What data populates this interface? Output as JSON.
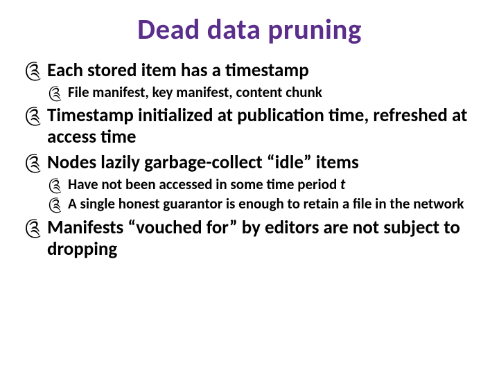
{
  "title": "Dead data pruning",
  "bullets": {
    "b1": "Each stored item has a timestamp",
    "b1a": "File manifest, key manifest, content chunk",
    "b2": "Timestamp initialized at publication time, refreshed at access time",
    "b3": "Nodes lazily garbage-collect “idle” items",
    "b3a_pre": "Have not been accessed in some time period ",
    "b3a_ital": "t",
    "b3b": "A single honest guarantor is enough to retain a file in the network",
    "b4": "Manifests “vouched for” by editors are not subject to dropping"
  },
  "glyph": "༊"
}
